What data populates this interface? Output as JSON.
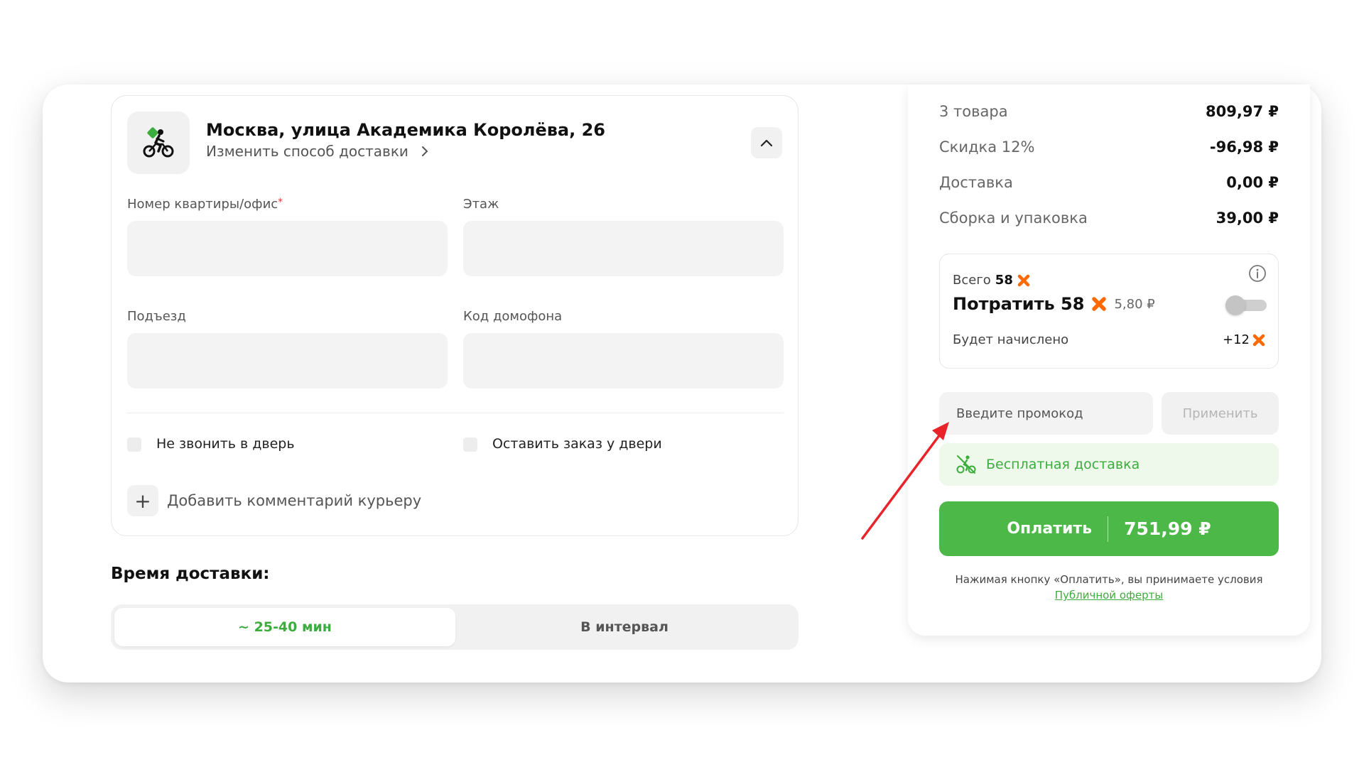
{
  "delivery": {
    "address": "Москва, улица Академика Королёва, 26",
    "change_link": "Изменить способ доставки",
    "fields": {
      "apartment_label": "Номер квартиры/офис",
      "apartment_required": "*",
      "floor_label": "Этаж",
      "entrance_label": "Подъезд",
      "intercom_label": "Код домофона"
    },
    "checks": {
      "no_call": "Не звонить в дверь",
      "leave_at_door": "Оставить заказ у двери"
    },
    "add_comment": "Добавить комментарий курьеру"
  },
  "time": {
    "title": "Время доставки:",
    "option_fast": "~ 25-40 мин",
    "option_interval": "В интервал"
  },
  "summary": {
    "rows": [
      {
        "label": "3 товара",
        "value": "809,97 ₽"
      },
      {
        "label": "Скидка 12%",
        "value": "-96,98 ₽"
      },
      {
        "label": "Доставка",
        "value": "0,00 ₽"
      },
      {
        "label": "Сборка и упаковка",
        "value": "39,00 ₽"
      }
    ],
    "bonus": {
      "total_label": "Всего",
      "total_value": "58",
      "spend_label": "Потратить 58",
      "spend_rub": "5,80 ₽",
      "accrue_label": "Будет начислено",
      "accrue_value": "+12"
    },
    "promo_placeholder": "Введите промокод",
    "apply_label": "Применить",
    "free_delivery": "Бесплатная доставка",
    "pay_label": "Оплатить",
    "pay_amount": "751,99 ₽",
    "terms_text": "Нажимая кнопку «Оплатить», вы принимаете условия",
    "terms_link": "Публичной оферты"
  },
  "colors": {
    "accent_green": "#4cb848",
    "bonus_orange": "#ff6a00",
    "arrow_red": "#e8232a"
  }
}
